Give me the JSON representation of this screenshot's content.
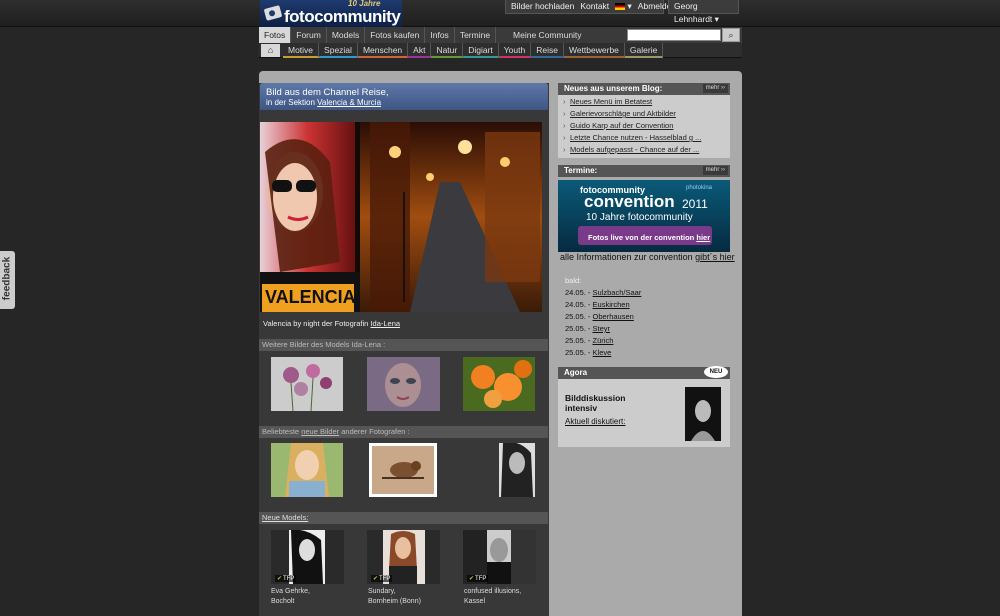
{
  "header": {
    "logo_years": "10 Jahre",
    "logo_name": "fotocommunity",
    "links": [
      "Bilder hochladen",
      "Kontakt",
      "Abmelden"
    ],
    "user": "Georg Lehnhardt"
  },
  "nav": {
    "items": [
      "Fotos",
      "Forum",
      "Models",
      "Fotos kaufen",
      "Infos",
      "Termine"
    ],
    "community": "Meine Community",
    "search_placeholder": ""
  },
  "subnav": {
    "items": [
      "Motive",
      "Spezial",
      "Menschen",
      "Akt",
      "Natur",
      "Digiart",
      "Youth",
      "Reise",
      "Wettbewerbe",
      "Galerie"
    ]
  },
  "feature": {
    "line1": "Bild aus dem Channel Reise,",
    "line2_prefix": "in der Sektion ",
    "line2_link": "Valencia & Murcia",
    "sign_text": "VALENCIA",
    "caption_prefix": "Valencia by night der Fotografin ",
    "caption_link": "Ida-Lena"
  },
  "sections": {
    "model_more": "Weitere Bilder des Models Ida-Lena :",
    "popular_prefix": "Beliebteste ",
    "popular_link": "neue Bilder",
    "popular_suffix": " anderer Fotografen :",
    "new_models": "Neue Models:"
  },
  "new_models": [
    {
      "name": "Eva Gehrke,",
      "place": "Bocholt",
      "badge": "TFP"
    },
    {
      "name": "Sundary,",
      "place": "Bornheim (Bonn)",
      "badge": "TFP"
    },
    {
      "name": "confused illusions,",
      "place": "Kassel",
      "badge": "TFP"
    }
  ],
  "blog": {
    "title": "Neues aus unserem Blog:",
    "more": "mehr",
    "items": [
      "Neues Menü im Betatest",
      "Galerievorschläge und Aktbilder",
      "Guido Karp auf der Convention",
      "Letzte Chance nutzen - Hasselblad g ...",
      "Models aufgepasst - Chance auf der ..."
    ]
  },
  "termine": {
    "title": "Termine:",
    "more": "mehr",
    "banner_top": "fotocommunity",
    "banner_sponsor": "photokina",
    "banner_main": "convention",
    "banner_year": "2011",
    "banner_sub": "10 Jahre fotocommunity",
    "banner_btn_prefix": "Fotos live von der convention ",
    "banner_btn_link": "hier",
    "info_prefix": "alle Informationen zur convention ",
    "info_link": "gibt´s hier",
    "soon": "bald:",
    "events": [
      {
        "date": "24.05. - ",
        "city": "Sulzbach/Saar"
      },
      {
        "date": "24.05. - ",
        "city": "Euskirchen"
      },
      {
        "date": "25.05. - ",
        "city": "Oberhausen"
      },
      {
        "date": "25.05. - ",
        "city": "Steyr"
      },
      {
        "date": "25.05. - ",
        "city": "Zürich"
      },
      {
        "date": "25.05. - ",
        "city": "Kleve"
      }
    ]
  },
  "agora": {
    "title": "Agora",
    "badge": "NEU",
    "line1": "Bilddiskussion",
    "line2": "intensiv",
    "link": "Aktuell diskutiert:"
  },
  "feedback": "feedback"
}
